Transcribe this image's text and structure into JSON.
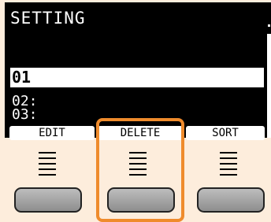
{
  "screen": {
    "title": "SETTING",
    "selected_row": "01",
    "rows": [
      "02:",
      "03:"
    ]
  },
  "softkeys": {
    "edit": "EDIT",
    "delete": "DELETE",
    "sort": "SORT"
  },
  "colors": {
    "background": "#fdeddc",
    "lcd": "#000000",
    "highlight": "#ef8b2c"
  }
}
